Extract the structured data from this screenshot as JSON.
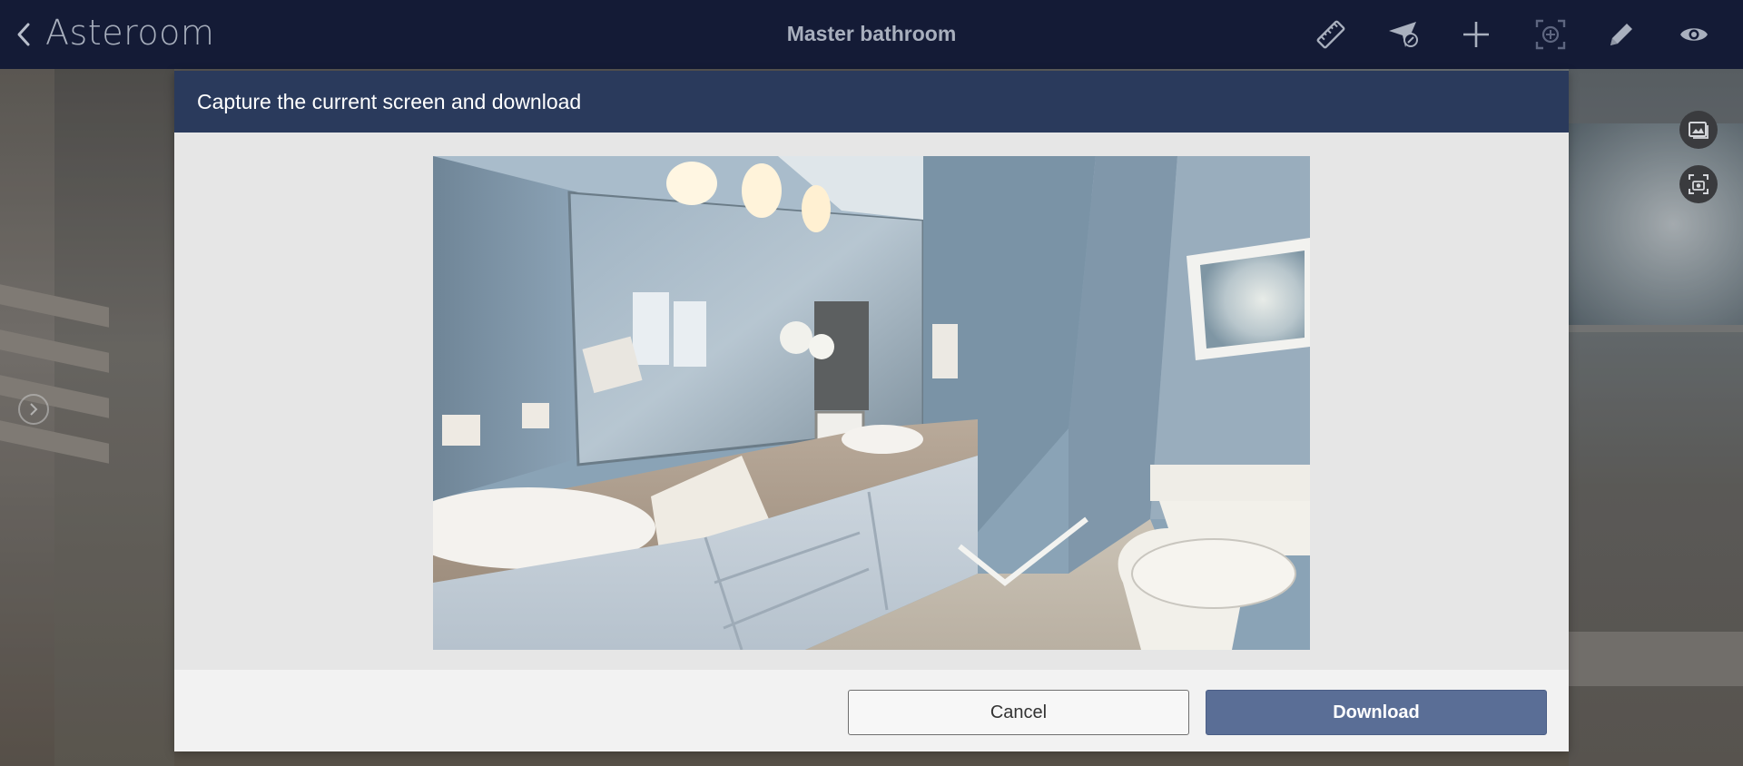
{
  "app": {
    "logo_text": "Asteroom",
    "back_icon": "chevron-left-icon",
    "page_title": "Master bathroom"
  },
  "toolbar": {
    "tools": [
      {
        "name": "measure",
        "icon": "ruler-icon"
      },
      {
        "name": "navigate",
        "icon": "paper-plane-icon"
      },
      {
        "name": "add",
        "icon": "plus-icon"
      },
      {
        "name": "focus",
        "icon": "focus-target-icon"
      },
      {
        "name": "edit",
        "icon": "pencil-icon"
      },
      {
        "name": "view",
        "icon": "eye-icon"
      }
    ]
  },
  "side_buttons": [
    {
      "name": "gallery",
      "icon": "image-icon"
    },
    {
      "name": "screenshot",
      "icon": "camera-capture-icon"
    }
  ],
  "nav": {
    "next_icon": "chevron-right-circle-icon"
  },
  "dialog": {
    "title": "Capture the current screen and download",
    "preview_alt": "Bathroom panorama preview",
    "cancel_label": "Cancel",
    "download_label": "Download"
  }
}
